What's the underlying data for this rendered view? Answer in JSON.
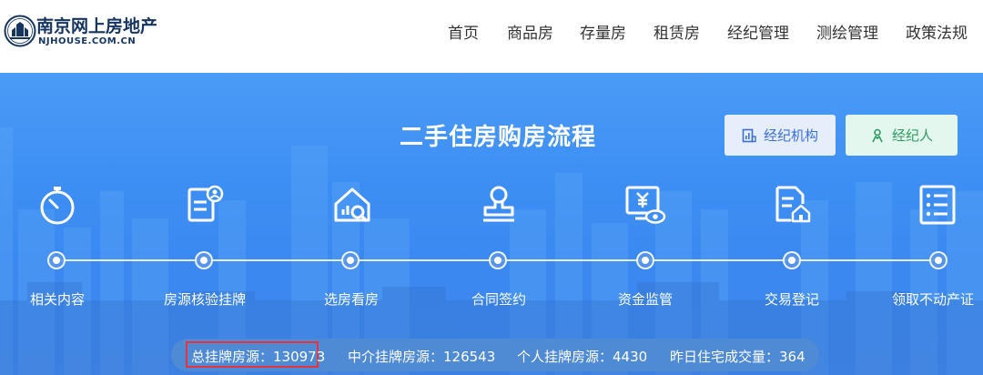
{
  "header": {
    "logo": {
      "name": "南京网上房地产",
      "domain": "NJHOUSE.COM.CN"
    },
    "nav": [
      {
        "label": "首页"
      },
      {
        "label": "商品房"
      },
      {
        "label": "存量房"
      },
      {
        "label": "租赁房"
      },
      {
        "label": "经纪管理"
      },
      {
        "label": "测绘管理"
      },
      {
        "label": "政策法规"
      }
    ]
  },
  "banner": {
    "title": "二手住房购房流程",
    "buttons": {
      "agency": {
        "label": "经纪机构",
        "icon": "building-chart-icon"
      },
      "agent": {
        "label": "经纪人",
        "icon": "person-icon"
      }
    },
    "steps": [
      {
        "label": "相关内容",
        "icon": "stopwatch-icon"
      },
      {
        "label": "房源核验挂牌",
        "icon": "document-person-icon"
      },
      {
        "label": "选房看房",
        "icon": "house-search-icon"
      },
      {
        "label": "合同签约",
        "icon": "stamp-icon"
      },
      {
        "label": "资金监管",
        "icon": "yuan-monitor-eye-icon"
      },
      {
        "label": "交易登记",
        "icon": "document-house-icon"
      },
      {
        "label": "领取不动产证",
        "icon": "checklist-icon"
      }
    ],
    "stats": [
      {
        "text": "总挂牌房源：130973"
      },
      {
        "text": "中介挂牌房源：126543"
      },
      {
        "text": "个人挂牌房源：4430"
      },
      {
        "text": "昨日住宅成交量：364"
      }
    ]
  },
  "colors": {
    "banner_blue": "#3d8ff4",
    "logo_navy": "#15345f",
    "highlight_red": "#e8323c",
    "agency_button_text": "#3b6fd8",
    "agent_button_text": "#2e9a62"
  }
}
